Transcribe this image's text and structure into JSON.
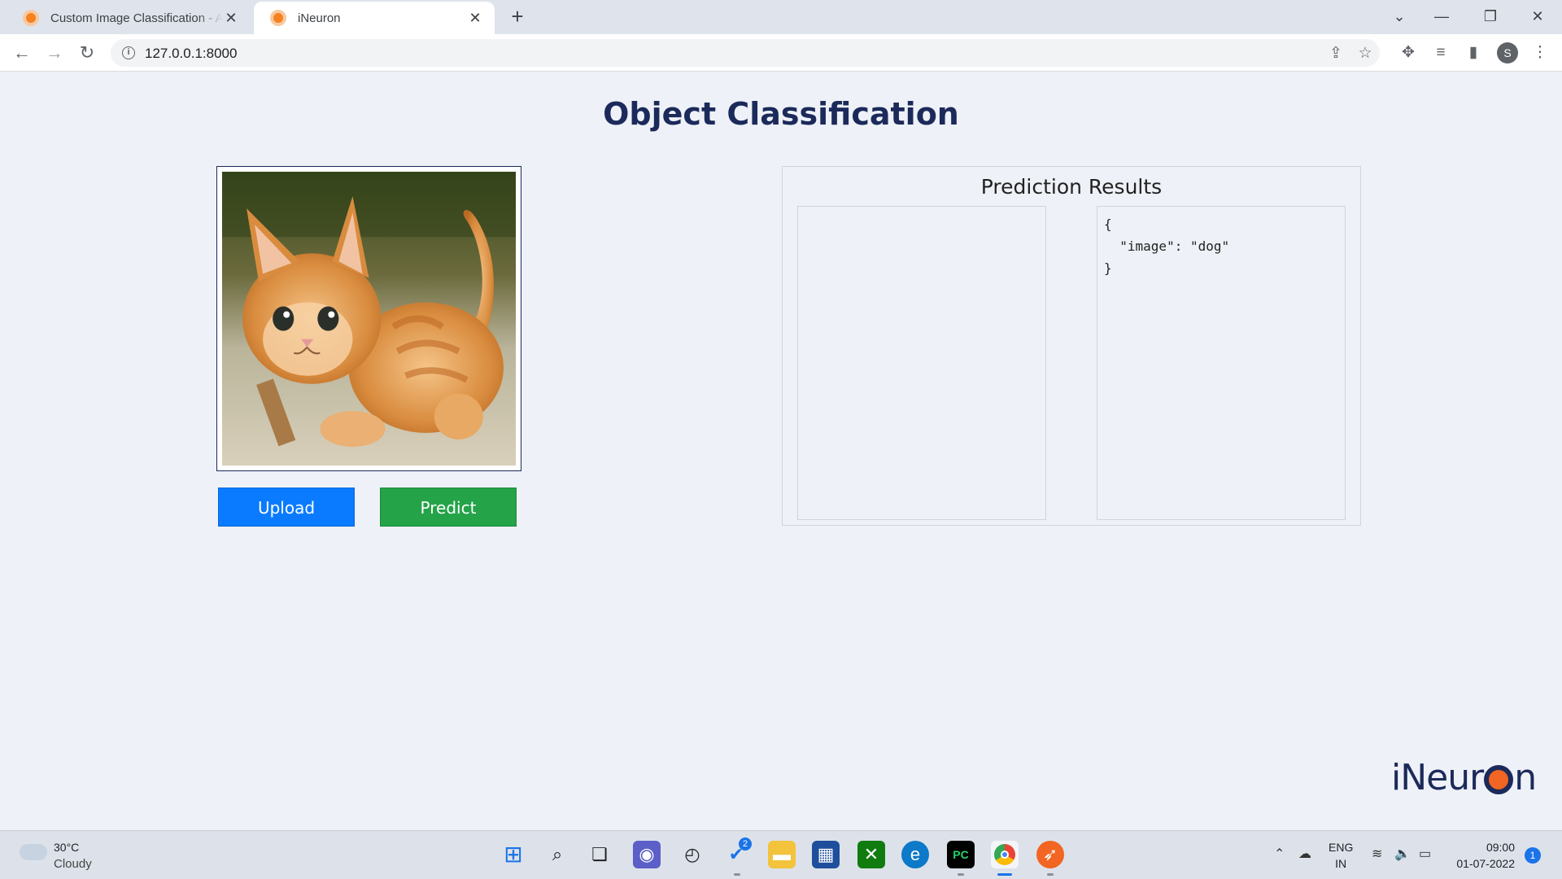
{
  "browser": {
    "tabs": [
      {
        "title": "Custom Image Classification - Ad",
        "active": false
      },
      {
        "title": "iNeuron",
        "active": true
      }
    ],
    "new_tab_icon": "+",
    "url": "127.0.0.1:8000"
  },
  "page": {
    "title": "Object Classification",
    "upload_button": "Upload",
    "predict_button": "Predict",
    "results_title": "Prediction Results",
    "json_output": "{\n  \"image\": \"dog\"\n}",
    "brand_prefix": "iNeur",
    "brand_suffix": "n"
  },
  "taskbar": {
    "weather_temp": "30°C",
    "weather_condition": "Cloudy",
    "todo_badge": "2",
    "language_line1": "ENG",
    "language_line2": "IN",
    "time": "09:00",
    "date": "01-07-2022",
    "notification_count": "1"
  },
  "colors": {
    "title": "#1b2a5a",
    "upload": "#0a7bff",
    "predict": "#24a348",
    "page_background": "#eef1f7"
  }
}
